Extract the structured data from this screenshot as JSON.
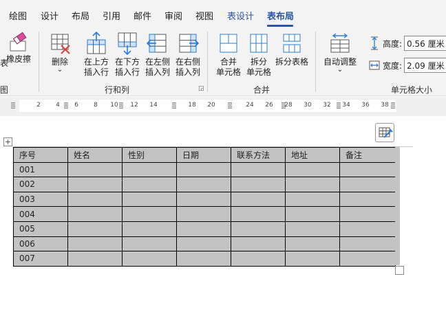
{
  "tabs": [
    {
      "label": "绘图"
    },
    {
      "label": "设计"
    },
    {
      "label": "布局"
    },
    {
      "label": "引用"
    },
    {
      "label": "邮件"
    },
    {
      "label": "审阅"
    },
    {
      "label": "视图"
    },
    {
      "label": "表设计"
    },
    {
      "label": "表布局"
    }
  ],
  "active_tab": "表布局",
  "ribbon": {
    "eraser": {
      "label": "橡皮擦"
    },
    "draw_group_label": "图",
    "delete": {
      "label": "删除",
      "arrow": "⌄"
    },
    "insert_above": {
      "line1": "在上方",
      "line2": "插入行"
    },
    "insert_below": {
      "line1": "在下方",
      "line2": "插入行"
    },
    "insert_left": {
      "line1": "在左侧",
      "line2": "插入列"
    },
    "insert_right": {
      "line1": "在右侧",
      "line2": "插入列"
    },
    "rows_cols_group_label": "行和列",
    "merge_cells": {
      "line1": "合并",
      "line2": "单元格"
    },
    "split_cells": {
      "line1": "拆分",
      "line2": "单元格"
    },
    "split_table": {
      "label": "拆分表格"
    },
    "merge_group_label": "合并",
    "autofit": {
      "label": "自动调整",
      "arrow": "⌄"
    },
    "height": {
      "label": "高度:",
      "value": "0.56 厘米"
    },
    "width": {
      "label": "宽度:",
      "value": "2.09 厘米"
    },
    "cell_size_group_label": "单元格大小"
  },
  "ruler": {
    "numbers": [
      "2",
      "4",
      "6",
      "8",
      "10",
      "12",
      "14",
      "18",
      "20",
      "24",
      "26",
      "28",
      "30",
      "32",
      "34",
      "36",
      "38"
    ]
  },
  "table": {
    "headers": [
      "序号",
      "姓名",
      "性别",
      "日期",
      "联系方法",
      "地址",
      "备注"
    ],
    "rows": [
      [
        "001",
        "",
        "",
        "",
        "",
        "",
        ""
      ],
      [
        "002",
        "",
        "",
        "",
        "",
        "",
        ""
      ],
      [
        "003",
        "",
        "",
        "",
        "",
        "",
        ""
      ],
      [
        "004",
        "",
        "",
        "",
        "",
        "",
        ""
      ],
      [
        "005",
        "",
        "",
        "",
        "",
        "",
        ""
      ],
      [
        "006",
        "",
        "",
        "",
        "",
        "",
        ""
      ],
      [
        "007",
        "",
        "",
        "",
        "",
        "",
        ""
      ]
    ]
  },
  "colors": {
    "accent": "#2b579a",
    "selection_fill": "#c3c3c3",
    "ribbon_bg": "#f3f3f3"
  }
}
